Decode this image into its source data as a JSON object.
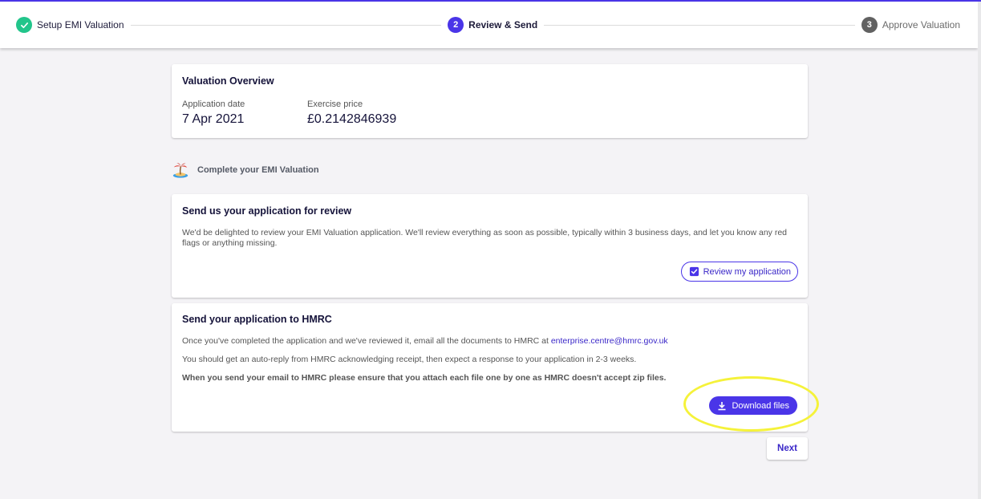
{
  "stepper": {
    "steps": [
      {
        "number": "",
        "label": "Setup EMI Valuation",
        "state": "done"
      },
      {
        "number": "2",
        "label": "Review & Send",
        "state": "active"
      },
      {
        "number": "3",
        "label": "Approve Valuation",
        "state": "pending"
      }
    ]
  },
  "overview": {
    "title": "Valuation Overview",
    "application_date_label": "Application date",
    "application_date_value": "7 Apr 2021",
    "exercise_price_label": "Exercise price",
    "exercise_price_value": "£0.2142846939"
  },
  "complete": {
    "heading": "Complete your EMI Valuation",
    "icon": "desert-island-icon"
  },
  "review_card": {
    "title": "Send us your application for review",
    "body": "We'd be delighted to review your EMI Valuation application. We'll review everything as soon as possible, typically within 3 business days, and let you know any red flags or anything missing.",
    "button_label": "Review my application"
  },
  "hmrc_card": {
    "title": "Send your application to HMRC",
    "p1_text": "Once you've completed the application and we've reviewed it, email all the documents to HMRC at ",
    "p1_link": "enterprise.centre@hmrc.gov.uk",
    "p2_text": "You should get an auto-reply from HMRC acknowledging receipt, then expect a response to your application in 2-3 weeks.",
    "p3_text": "When you send your email to HMRC please ensure that you attach each file one by one as HMRC doesn't accept zip files.",
    "button_label": "Download files"
  },
  "footer": {
    "next_label": "Next"
  },
  "colors": {
    "accent": "#4a35e8",
    "success": "#22c58b",
    "highlight": "#f5f23a"
  }
}
